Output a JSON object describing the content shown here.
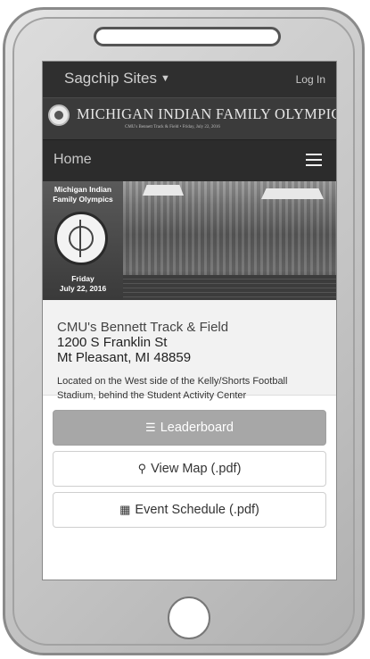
{
  "topbar": {
    "sites_label": "Sagchip Sites",
    "login_label": "Log In"
  },
  "banner": {
    "title": "MICHIGAN INDIAN FAMILY OLYMPICS",
    "subtitle": "CMU's Bennett Track & Field • Friday, July 22, 2016"
  },
  "nav": {
    "home_label": "Home"
  },
  "hero": {
    "title": "Michigan Indian Family Olympics",
    "day": "Friday",
    "date": "July 22, 2016"
  },
  "venue": {
    "name": "CMU's Bennett Track & Field",
    "street": "1200 S Franklin St",
    "city": "Mt Pleasant, MI 48859",
    "description": "Located on the West side of the Kelly/Shorts Football Stadium, behind the Student Activity Center"
  },
  "actions": {
    "leaderboard": "Leaderboard",
    "view_map": "View Map (.pdf)",
    "event_schedule": "Event Schedule (.pdf)"
  },
  "icons": [
    "list-icon",
    "map-marker-icon",
    "calendar-icon",
    "menu-icon",
    "caret-down-icon"
  ],
  "colors": {
    "topbar": "#2f2f2f",
    "primary_button": "#a7a7a7",
    "info_bg": "#f2f2f2"
  }
}
